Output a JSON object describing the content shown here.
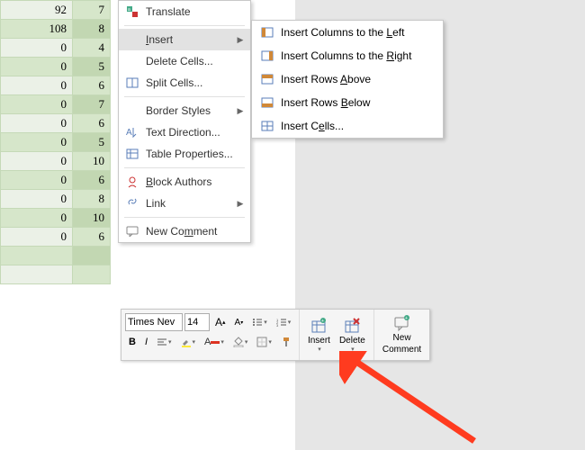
{
  "table": {
    "rows": [
      {
        "a": "92",
        "b": "7"
      },
      {
        "a": "108",
        "b": "8"
      },
      {
        "a": "0",
        "b": "4"
      },
      {
        "a": "0",
        "b": "5"
      },
      {
        "a": "0",
        "b": "6"
      },
      {
        "a": "0",
        "b": "7"
      },
      {
        "a": "0",
        "b": "6"
      },
      {
        "a": "0",
        "b": "5"
      },
      {
        "a": "0",
        "b": "10"
      },
      {
        "a": "0",
        "b": "6"
      },
      {
        "a": "0",
        "b": "8"
      },
      {
        "a": "0",
        "b": "10"
      },
      {
        "a": "0",
        "b": "6"
      }
    ]
  },
  "ctx": {
    "translate": "Translate",
    "insert": "Insert",
    "delete": "Delete Cells...",
    "split": "Split Cells...",
    "border": "Border Styles",
    "textdir": "Text Direction...",
    "tableprops": "Table Properties...",
    "block": "Block Authors",
    "link": "Link",
    "comment": "New Comment"
  },
  "submenu": {
    "colsleft": "Insert Columns to the Left",
    "colsright": "Insert Columns to the Right",
    "rowsabove": "Insert Rows Above",
    "rowsbelow": "Insert Rows Below",
    "cells": "Insert Cells..."
  },
  "toolbar": {
    "font": "Times Nev",
    "size": "14",
    "insert": "Insert",
    "delete": "Delete",
    "newcomment_line1": "New",
    "newcomment_line2": "Comment"
  }
}
